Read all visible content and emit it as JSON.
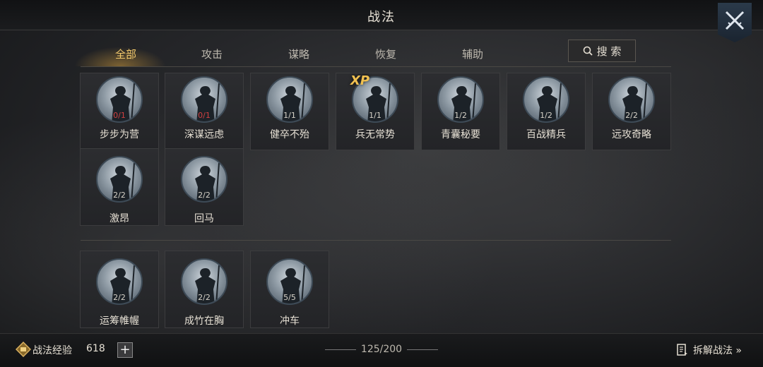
{
  "header": {
    "title": "战法"
  },
  "tabs": [
    "全部",
    "攻击",
    "谋略",
    "恢复",
    "辅助"
  ],
  "search": {
    "label": "搜 索"
  },
  "tactics_group1": [
    {
      "name": "步步为营",
      "count": "0/1",
      "count_color": "red",
      "xp": ""
    },
    {
      "name": "深谋远虑",
      "count": "0/1",
      "count_color": "red",
      "xp": ""
    },
    {
      "name": "健卒不殆",
      "count": "1/1",
      "count_color": "normal",
      "xp": ""
    },
    {
      "name": "兵无常势",
      "count": "1/1",
      "count_color": "normal",
      "xp": "XP"
    },
    {
      "name": "青囊秘要",
      "count": "1/2",
      "count_color": "normal",
      "xp": ""
    },
    {
      "name": "百战精兵",
      "count": "1/2",
      "count_color": "normal",
      "xp": ""
    },
    {
      "name": "远攻奇略",
      "count": "2/2",
      "count_color": "normal",
      "xp": ""
    },
    {
      "name": "激昂",
      "count": "2/2",
      "count_color": "normal",
      "xp": ""
    },
    {
      "name": "回马",
      "count": "2/2",
      "count_color": "normal",
      "xp": ""
    }
  ],
  "tactics_group2": [
    {
      "name": "运筹帷幄",
      "count": "2/2",
      "count_color": "normal"
    },
    {
      "name": "成竹在胸",
      "count": "2/2",
      "count_color": "normal"
    },
    {
      "name": "冲车",
      "count": "5/5",
      "count_color": "normal"
    }
  ],
  "footer": {
    "exp_label": "战法经验",
    "exp_value": "618",
    "plus": "+",
    "capacity": "125/200",
    "decompose_label": "拆解战法 »"
  },
  "colors": {
    "accent": "#f2c96c",
    "red_count": "#d04040"
  },
  "icons": [
    "crossed-swords-icon",
    "search-icon",
    "plus-icon",
    "book-icon",
    "exp-coin-icon"
  ]
}
